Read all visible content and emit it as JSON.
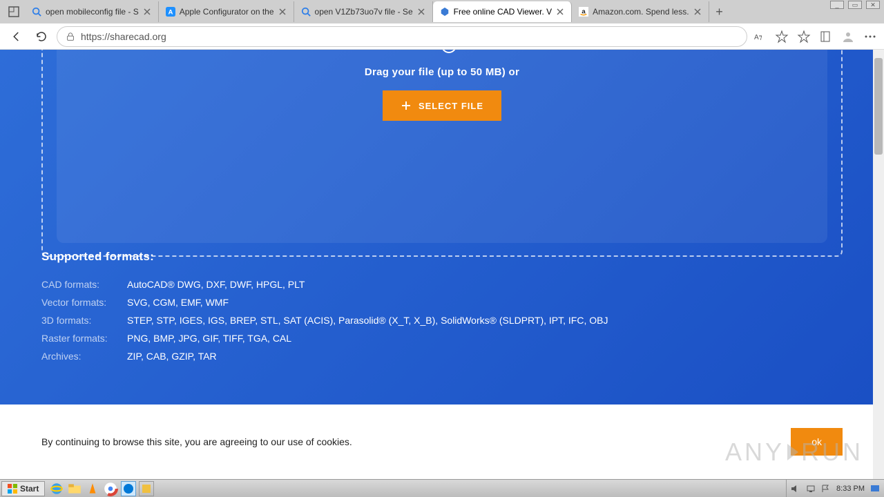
{
  "window": {
    "minimize": "_",
    "maximize": "▭",
    "close": "✕"
  },
  "tabs": [
    {
      "title": "open mobileconfig file - S",
      "active": false
    },
    {
      "title": "Apple Configurator on the",
      "active": false
    },
    {
      "title": "open V1Zb73uo7v file - Se",
      "active": false
    },
    {
      "title": "Free online CAD Viewer. V",
      "active": true
    },
    {
      "title": "Amazon.com. Spend less.",
      "active": false
    }
  ],
  "addressbar": {
    "url": "https://sharecad.org"
  },
  "page": {
    "drag_text": "Drag your file (up to 50 MB) or",
    "select_file": "SELECT FILE",
    "supported_heading": "Supported formats:",
    "formats": [
      {
        "label": "CAD formats:",
        "values": "AutoCAD® DWG, DXF, DWF, HPGL, PLT"
      },
      {
        "label": "Vector formats:",
        "values": "SVG, CGM, EMF, WMF"
      },
      {
        "label": "3D formats:",
        "values": "STEP, STP, IGES, IGS, BREP, STL, SAT (ACIS), Parasolid® (X_T, X_B), SolidWorks® (SLDPRT), IPT, IFC, OBJ"
      },
      {
        "label": "Raster formats:",
        "values": "PNG, BMP, JPG, GIF, TIFF, TGA, CAL"
      },
      {
        "label": "Archives:",
        "values": "ZIP, CAB, GZIP, TAR"
      }
    ],
    "cookie_msg": "By continuing to browse this site, you are agreeing to our use of cookies.",
    "cookie_ok": "ok"
  },
  "watermark": {
    "text_a": "ANY",
    "text_b": "RUN"
  },
  "taskbar": {
    "start": "Start",
    "time": "8:33 PM"
  }
}
